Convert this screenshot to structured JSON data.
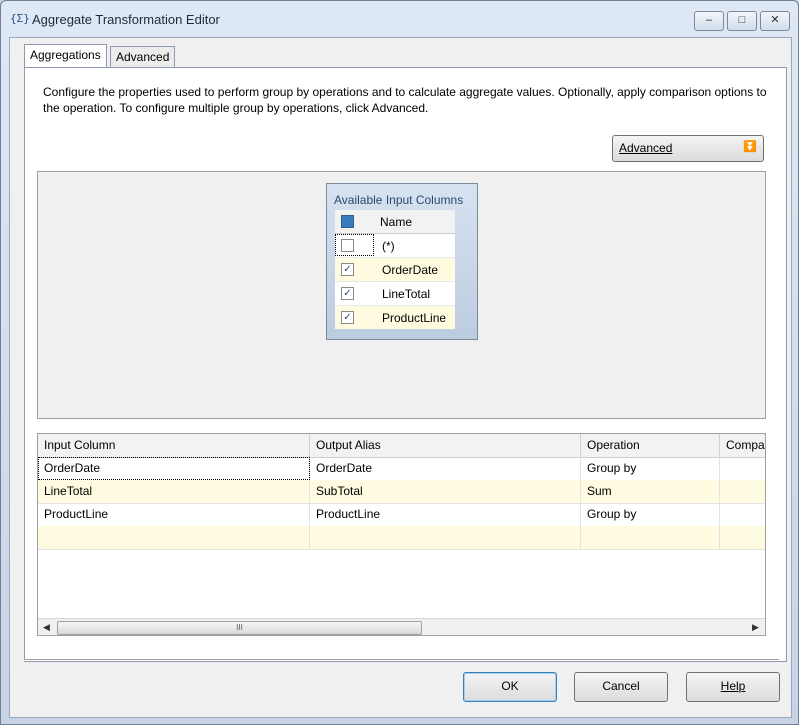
{
  "window": {
    "title": "Aggregate Transformation Editor",
    "icon": "aggregate-transform-icon",
    "controls": {
      "minimize": "–",
      "restore": "□",
      "close": "✕"
    }
  },
  "tabs": [
    {
      "label": "Aggregations",
      "active": true
    },
    {
      "label": "Advanced",
      "active": false
    }
  ],
  "description": "Configure the properties used to perform group by operations and to calculate aggregate values. Optionally, apply comparison options to the operation. To configure multiple group by operations, click Advanced.",
  "advanced_button": {
    "label": "Advanced",
    "icon": "double-chevron-down-icon",
    "glyph": "⏬"
  },
  "available_columns": {
    "header": "Available Input Columns",
    "name_header": "Name",
    "rows": [
      {
        "name": "(*)",
        "checked": false
      },
      {
        "name": "OrderDate",
        "checked": true
      },
      {
        "name": "LineTotal",
        "checked": true
      },
      {
        "name": "ProductLine",
        "checked": true
      }
    ]
  },
  "grid": {
    "headers": [
      "Input Column",
      "Output Alias",
      "Operation",
      "Compar"
    ],
    "rows": [
      [
        "OrderDate",
        "OrderDate",
        "Group by",
        ""
      ],
      [
        "LineTotal",
        "SubTotal",
        "Sum",
        ""
      ],
      [
        "ProductLine",
        "ProductLine",
        "Group by",
        ""
      ],
      [
        "",
        "",
        "",
        ""
      ]
    ],
    "scroll_grip": "III"
  },
  "buttons": {
    "ok": "OK",
    "cancel": "Cancel",
    "help": "Help"
  },
  "colors": {
    "selection_row": "#fffbe0",
    "accent": "#3a7cc0"
  }
}
